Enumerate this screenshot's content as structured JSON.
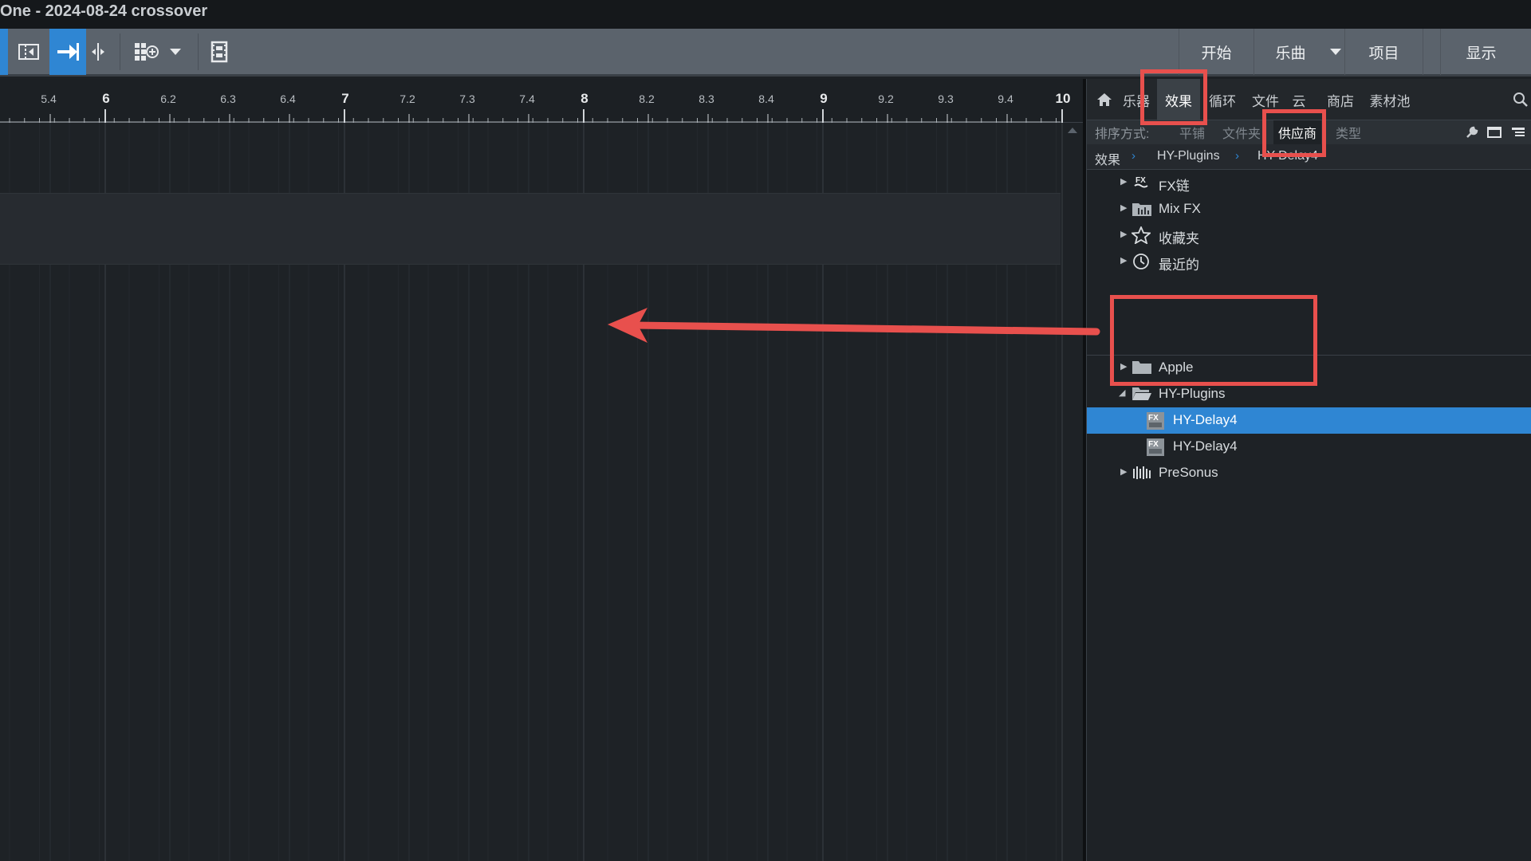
{
  "window": {
    "title": "One - 2024-08-24 crossover"
  },
  "toolbar": {
    "buttons": [
      {
        "name": "split-view-icon"
      },
      {
        "name": "snap-arrow-icon"
      },
      {
        "name": "split-cursor-icon"
      },
      {
        "name": "grid-add-icon"
      },
      {
        "name": "dropdown-icon"
      },
      {
        "name": "film-icon"
      }
    ],
    "right": {
      "start": "开始",
      "song": "乐曲",
      "project": "项目",
      "show": "显示"
    }
  },
  "ruler": {
    "ticks": [
      "5.4",
      "6",
      "6.2",
      "6.3",
      "6.4",
      "7",
      "7.2",
      "7.3",
      "7.4",
      "8",
      "8.2",
      "8.3",
      "8.4",
      "9",
      "9.2",
      "9.3",
      "9.4",
      "10"
    ],
    "bars": [
      "6",
      "7",
      "8",
      "9",
      "10"
    ]
  },
  "browser": {
    "tabs": [
      "乐器",
      "效果",
      "循环",
      "文件",
      "云",
      "商店",
      "素材池"
    ],
    "selected_tab": "效果",
    "sort": {
      "label": "排序方式:",
      "options": [
        "平铺",
        "文件夹",
        "供应商",
        "类型"
      ],
      "selected": "供应商"
    },
    "breadcrumb": [
      "效果",
      "HY-Plugins",
      "HY-Delay4"
    ],
    "tree": [
      {
        "label": "FX链",
        "icon": "fx-chain-icon",
        "expanded": false
      },
      {
        "label": "Mix FX",
        "icon": "mixfx-folder-icon",
        "expanded": false
      },
      {
        "label": "收藏夹",
        "icon": "star-icon",
        "expanded": false
      },
      {
        "label": "最近的",
        "icon": "clock-icon",
        "expanded": false
      },
      {
        "label": "Apple",
        "icon": "folder-icon",
        "expanded": false
      },
      {
        "label": "HY-Plugins",
        "icon": "folder-open-icon",
        "expanded": true
      },
      {
        "label": "HY-Delay4",
        "icon": "vst-plugin-icon",
        "selected": true
      },
      {
        "label": "HY-Delay4",
        "icon": "au-plugin-icon",
        "selected": false
      },
      {
        "label": "PreSonus",
        "icon": "presonus-icon",
        "expanded": false
      }
    ]
  },
  "colors": {
    "accent": "#2f86d3",
    "annotation": "#e8504d"
  }
}
